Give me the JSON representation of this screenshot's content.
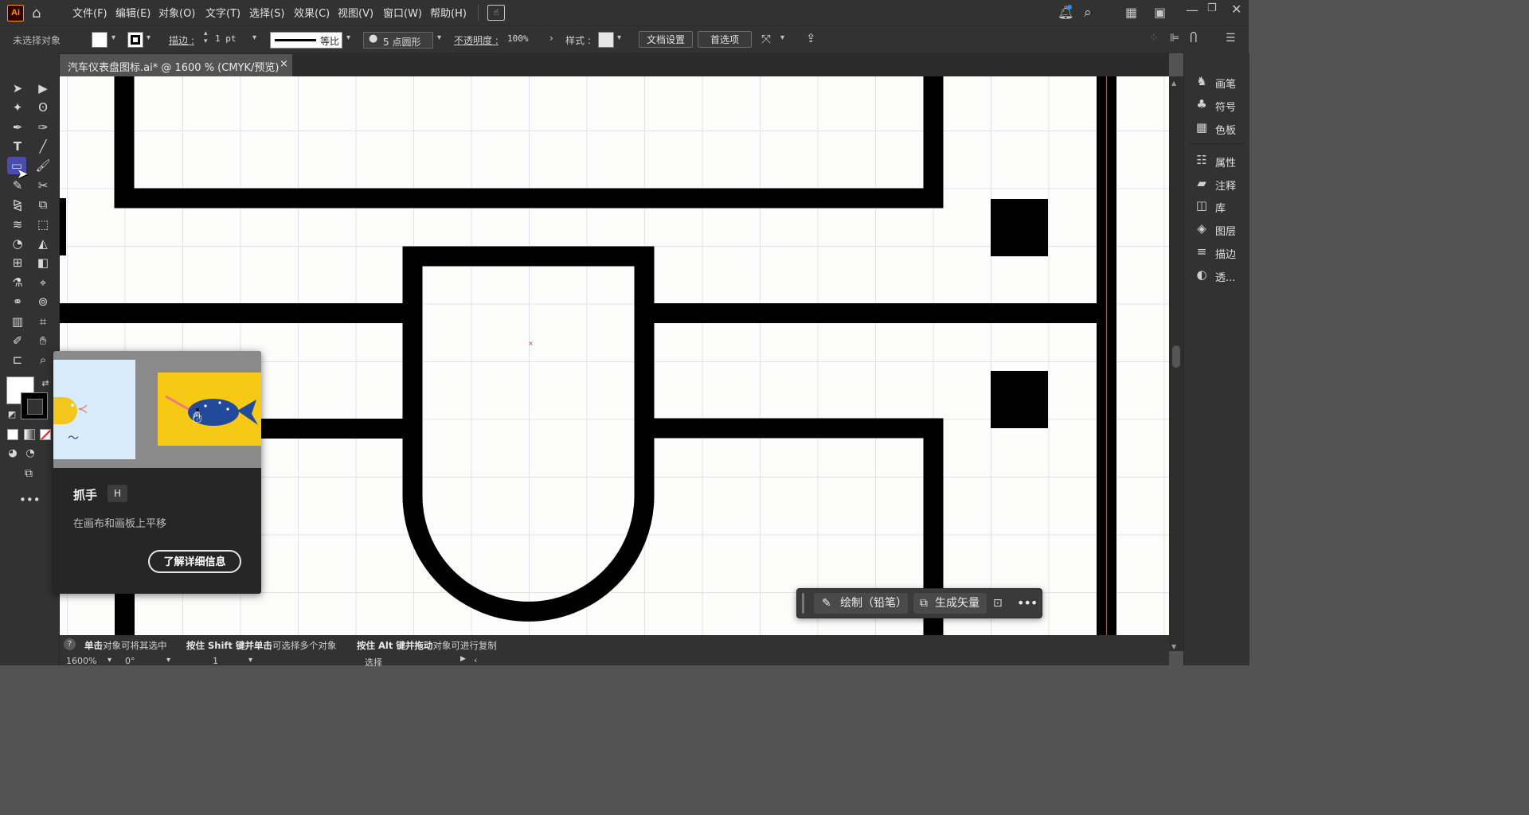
{
  "menubar": {
    "logo": "Ai",
    "items": [
      "文件(F)",
      "编辑(E)",
      "对象(O)",
      "文字(T)",
      "选择(S)",
      "效果(C)",
      "视图(V)",
      "窗口(W)",
      "帮助(H)"
    ]
  },
  "control_bar": {
    "selection_status": "未选择对象",
    "stroke_label": "描边 :",
    "stroke_weight": "1 pt",
    "stroke_profile": "等比",
    "brush": "5 点圆形",
    "opacity_label": "不透明度 :",
    "opacity_value": "100%",
    "style_label": "样式 :",
    "doc_setup_button": "文档设置",
    "preferences_button": "首选项"
  },
  "document_tab": {
    "title": "汽车仪表盘图标.ai* @ 1600 % (CMYK/预览)",
    "close": "×"
  },
  "right_panel": {
    "items": [
      {
        "label": "画笔",
        "icon": "brush-icon"
      },
      {
        "label": "符号",
        "icon": "club-symbol-icon"
      },
      {
        "label": "色板",
        "icon": "swatches-icon"
      },
      {
        "label": "属性",
        "icon": "sliders-icon"
      },
      {
        "label": "注释",
        "icon": "comment-icon"
      },
      {
        "label": "库",
        "icon": "library-icon"
      },
      {
        "label": "图层",
        "icon": "layers-icon"
      },
      {
        "label": "描边",
        "icon": "stroke-icon"
      },
      {
        "label": "透...",
        "icon": "transparency-icon"
      }
    ]
  },
  "tooltip": {
    "title": "抓手",
    "shortcut": "H",
    "description": "在画布和画板上平移",
    "learn_more": "了解详细信息"
  },
  "context_bar": {
    "draw_label": "绘制（铅笔）",
    "generate_label": "生成矢量"
  },
  "status_bar": {
    "hint1_bold": "单击",
    "hint1": "对象可将其选中",
    "hint2_pre": "按住 ",
    "hint2_bold": "Shift 键并单击",
    "hint2": "可选择多个对象",
    "hint3_pre": "按住 ",
    "hint3_bold": "Alt 键并拖动",
    "hint3": "对象可进行复制",
    "zoom": "1600%",
    "rotation": "0°",
    "artboard": "1",
    "tool_status": "选择"
  },
  "colors": {
    "accent": "#ff9a00",
    "guide_red": "#e0343a",
    "artwork": "#000000"
  }
}
